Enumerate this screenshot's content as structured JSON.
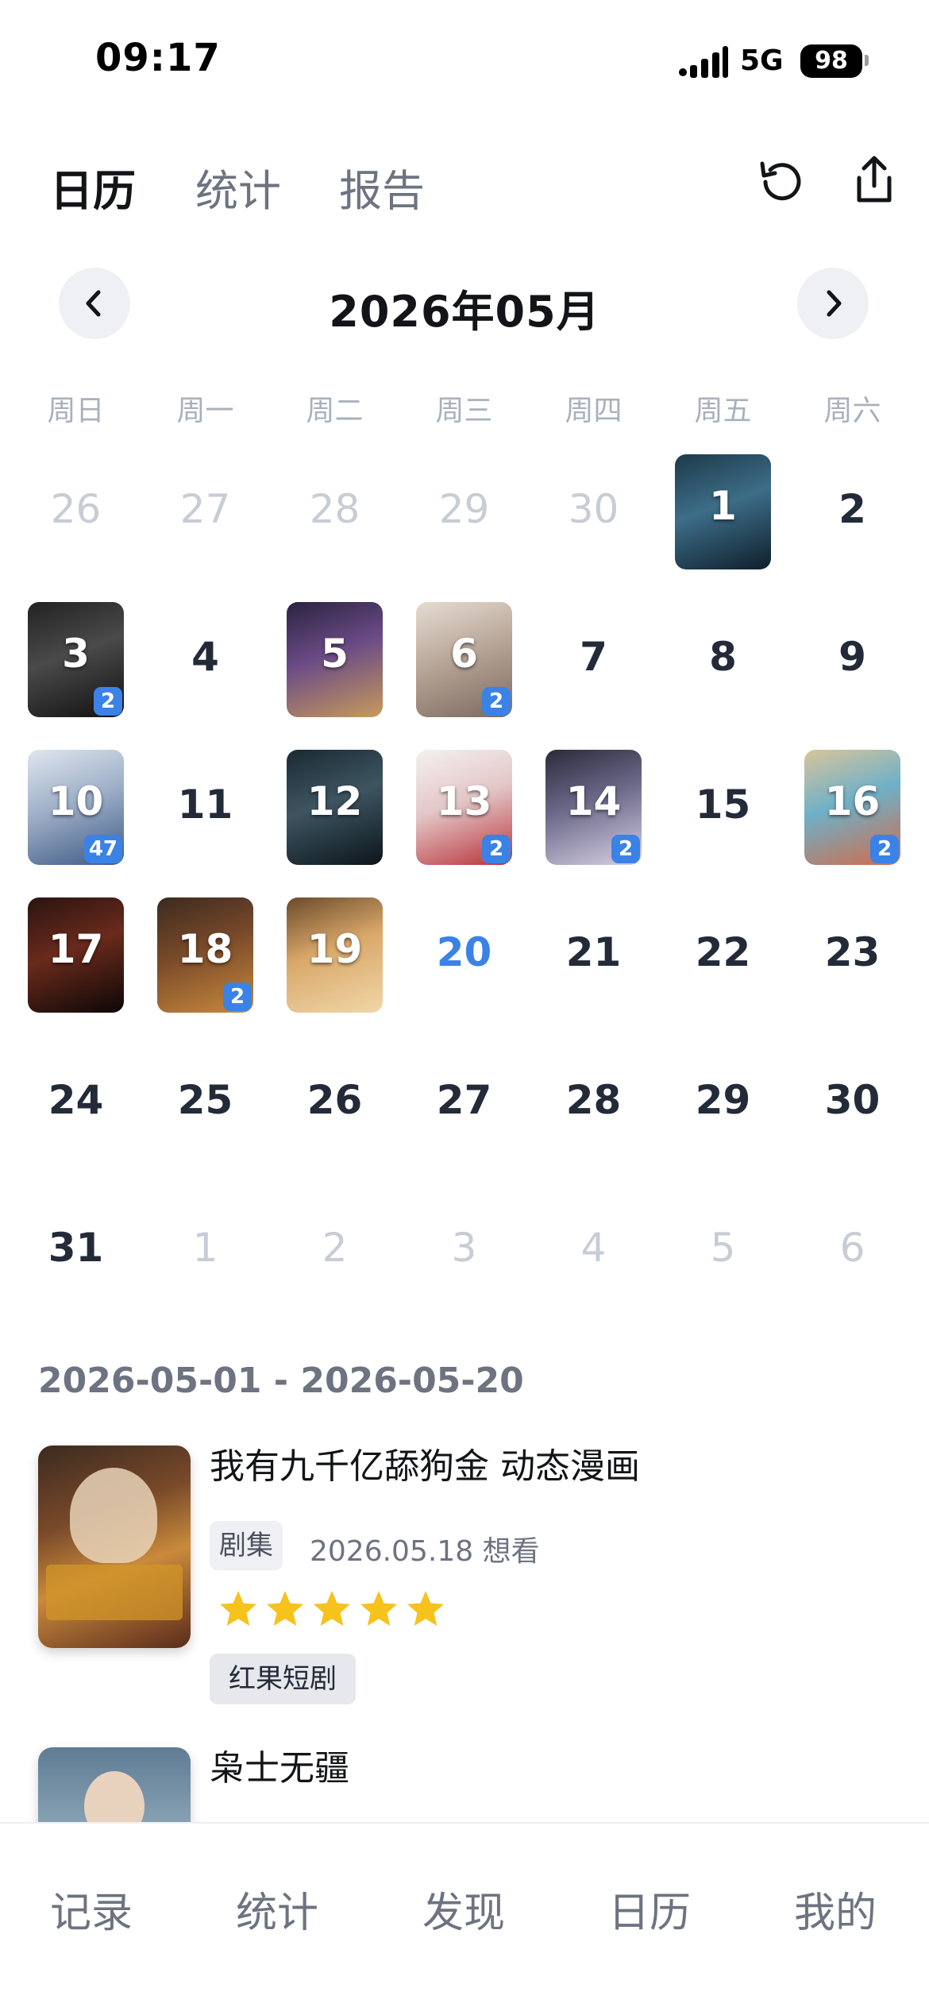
{
  "status_bar": {
    "time": "09:17",
    "network": "5G",
    "battery": "98"
  },
  "top_tabs": [
    {
      "label": "日历",
      "active": true
    },
    {
      "label": "统计",
      "active": false
    },
    {
      "label": "报告",
      "active": false
    }
  ],
  "top_actions": {
    "history_icon": "history-icon",
    "share_icon": "share-icon"
  },
  "calendar": {
    "title": "2026年05月",
    "prev_icon": "chevron-left-icon",
    "next_icon": "chevron-right-icon",
    "weekdays": [
      "周日",
      "周一",
      "周二",
      "周三",
      "周四",
      "周五",
      "周六"
    ],
    "weeks": [
      [
        {
          "d": "26",
          "dim": true
        },
        {
          "d": "27",
          "dim": true
        },
        {
          "d": "28",
          "dim": true
        },
        {
          "d": "29",
          "dim": true
        },
        {
          "d": "30",
          "dim": true
        },
        {
          "d": "1",
          "poster": true
        },
        {
          "d": "2"
        }
      ],
      [
        {
          "d": "3",
          "poster": true,
          "badge": "2"
        },
        {
          "d": "4"
        },
        {
          "d": "5",
          "poster": true
        },
        {
          "d": "6",
          "poster": true,
          "badge": "2"
        },
        {
          "d": "7"
        },
        {
          "d": "8"
        },
        {
          "d": "9"
        }
      ],
      [
        {
          "d": "10",
          "poster": true,
          "badge": "47"
        },
        {
          "d": "11"
        },
        {
          "d": "12",
          "poster": true
        },
        {
          "d": "13",
          "poster": true,
          "badge": "2"
        },
        {
          "d": "14",
          "poster": true,
          "badge": "2"
        },
        {
          "d": "15"
        },
        {
          "d": "16",
          "poster": true,
          "badge": "2"
        }
      ],
      [
        {
          "d": "17",
          "poster": true
        },
        {
          "d": "18",
          "poster": true,
          "badge": "2"
        },
        {
          "d": "19",
          "poster": true
        },
        {
          "d": "20",
          "today": true
        },
        {
          "d": "21"
        },
        {
          "d": "22"
        },
        {
          "d": "23"
        }
      ],
      [
        {
          "d": "24"
        },
        {
          "d": "25"
        },
        {
          "d": "26"
        },
        {
          "d": "27"
        },
        {
          "d": "28"
        },
        {
          "d": "29"
        },
        {
          "d": "30"
        }
      ],
      [
        {
          "d": "31"
        },
        {
          "d": "1",
          "dim": true
        },
        {
          "d": "2",
          "dim": true
        },
        {
          "d": "3",
          "dim": true
        },
        {
          "d": "4",
          "dim": true
        },
        {
          "d": "5",
          "dim": true
        },
        {
          "d": "6",
          "dim": true
        }
      ]
    ]
  },
  "records": {
    "range": "2026-05-01 - 2026-05-20",
    "items": [
      {
        "title": "我有九千亿舔狗金 动态漫画",
        "type": "剧集",
        "meta": "2026.05.18 想看",
        "rating": 5,
        "platform": "红果短剧"
      },
      {
        "title": "枭士无疆"
      }
    ]
  },
  "bottom_nav": [
    {
      "label": "记录",
      "active": false
    },
    {
      "label": "统计",
      "active": true
    },
    {
      "label": "发现",
      "active": false
    },
    {
      "label": "日历",
      "active": false
    },
    {
      "label": "我的",
      "active": false
    }
  ],
  "colors": {
    "accent": "#3b82e6",
    "star": "#f6c21c",
    "today": "#3b82e6"
  }
}
